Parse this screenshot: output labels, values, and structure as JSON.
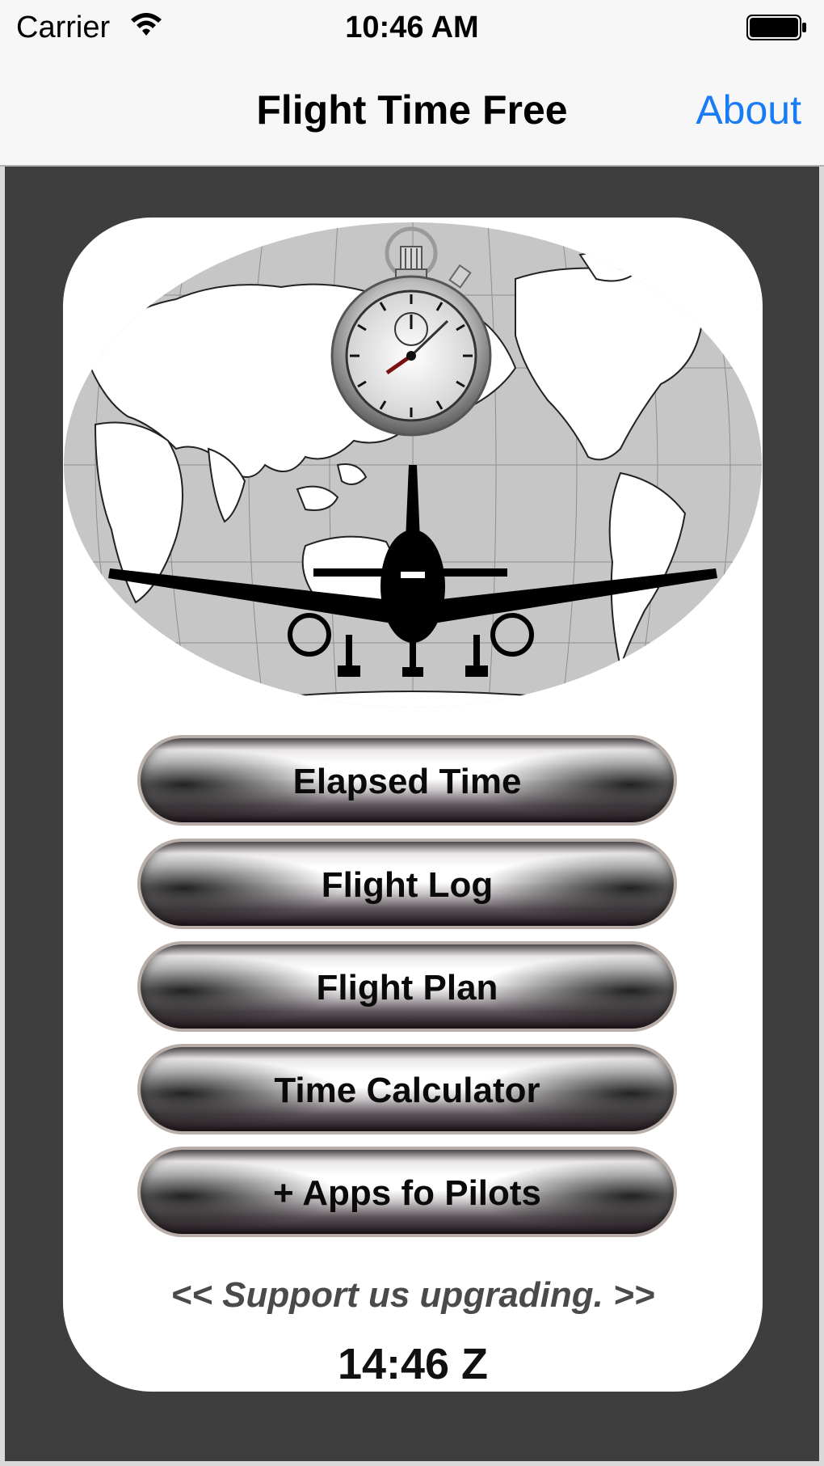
{
  "status_bar": {
    "carrier": "Carrier",
    "time": "10:46 AM",
    "icons": [
      "wifi-icon",
      "battery-icon"
    ]
  },
  "nav_bar": {
    "title": "Flight Time Free",
    "about_label": "About"
  },
  "hero": {
    "icons": [
      "world-map",
      "stopwatch-icon",
      "airplane-icon"
    ]
  },
  "menu": {
    "buttons": [
      {
        "label": "Elapsed Time"
      },
      {
        "label": "Flight Log"
      },
      {
        "label": "Flight Plan"
      },
      {
        "label": "Time Calculator"
      },
      {
        "label": "+ Apps fo Pilots"
      }
    ]
  },
  "footer": {
    "support_text": "<< Support us upgrading. >>",
    "zulu_time": "14:46 Z"
  },
  "colors": {
    "accent": "#1a7cf5",
    "frame": "#3e3e3e",
    "card": "#ffffff"
  }
}
